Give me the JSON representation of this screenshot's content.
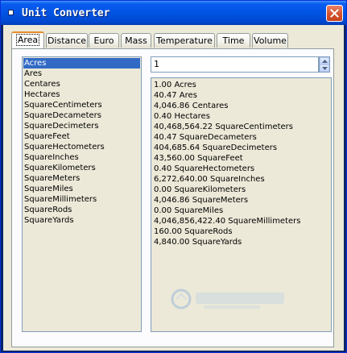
{
  "window": {
    "title": "Unit Converter"
  },
  "tabs": [
    {
      "label": "Area",
      "active": true
    },
    {
      "label": "Distance",
      "active": false
    },
    {
      "label": "Euro",
      "active": false
    },
    {
      "label": "Mass",
      "active": false
    },
    {
      "label": "Temperature",
      "active": false
    },
    {
      "label": "Time",
      "active": false
    },
    {
      "label": "Volume",
      "active": false
    }
  ],
  "units": {
    "selected_index": 0,
    "items": [
      "Acres",
      "Ares",
      "Centares",
      "Hectares",
      "SquareCentimeters",
      "SquareDecameters",
      "SquareDecimeters",
      "SquareFeet",
      "SquareHectometers",
      "SquareInches",
      "SquareKilometers",
      "SquareMeters",
      "SquareMiles",
      "SquareMillimeters",
      "SquareRods",
      "SquareYards"
    ]
  },
  "input": {
    "value": "1"
  },
  "results": [
    "1.00 Acres",
    "40.47 Ares",
    "4,046.86 Centares",
    "0.40 Hectares",
    "40,468,564.22 SquareCentimeters",
    "40.47 SquareDecameters",
    "404,685.64 SquareDecimeters",
    "43,560.00 SquareFeet",
    "0.40 SquareHectometers",
    "6,272,640.00 SquareInches",
    "0.00 SquareKilometers",
    "4,046.86 SquareMeters",
    "0.00 SquareMiles",
    "4,046,856,422.40 SquareMillimeters",
    "160.00 SquareRods",
    "4,840.00 SquareYards"
  ],
  "icons": {
    "title": "app-icon",
    "close": "close-icon",
    "spin_up": "arrow-up-icon",
    "spin_down": "arrow-down-icon"
  },
  "colors": {
    "titlebar": "#0054e3",
    "selection": "#316ac5",
    "active_tab_accent": "#e68b2c",
    "close_button": "#d7552f"
  }
}
